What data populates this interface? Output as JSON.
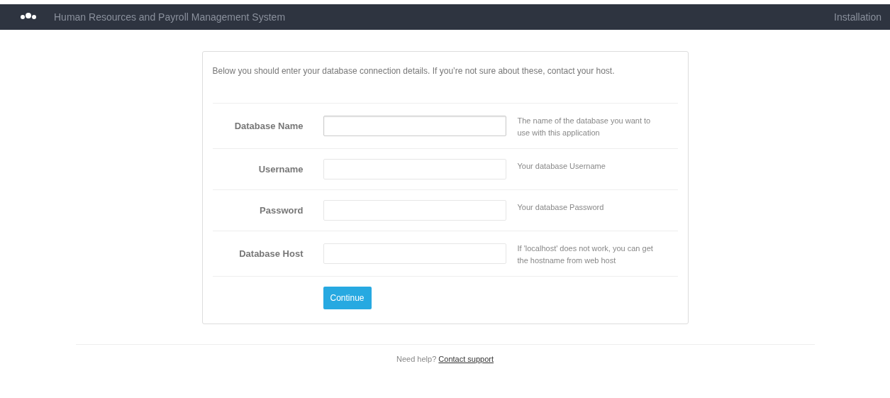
{
  "header": {
    "title": "Human Resources and Payroll Management System",
    "right_link": "Installation"
  },
  "intro": "Below you should enter your database connection details. If you’re not sure about these, contact your host.",
  "fields": [
    {
      "label": "Database Name",
      "hint": "The name of the database you want to use with this application",
      "focused": true
    },
    {
      "label": "Username",
      "hint": "Your database Username",
      "focused": false
    },
    {
      "label": "Password",
      "hint": "Your database Password",
      "focused": false
    },
    {
      "label": "Database Host",
      "hint": "If 'localhost' does not work, you can get the hostname from web host",
      "focused": false
    }
  ],
  "submit": "Continue",
  "footer": {
    "text": "Need help?",
    "link": "Contact support"
  }
}
